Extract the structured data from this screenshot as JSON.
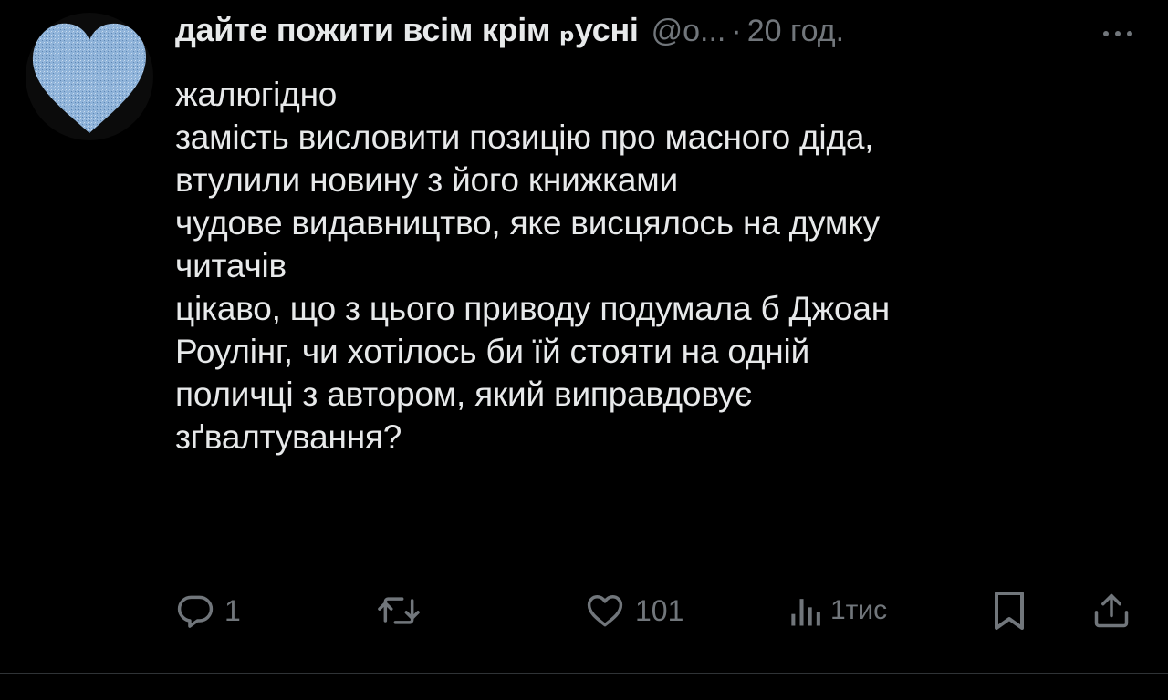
{
  "tweet": {
    "display_name": "дайте пожити всім крім ₚусні",
    "handle": "@o...",
    "separator": "·",
    "time": "20 год.",
    "body_lines": [
      "жалюгідно",
      "замість висловити позицію про масного діда,",
      "втулили новину з його книжками",
      "чудове видавництво, яке висцялось на думку",
      "читачів",
      "цікаво, що з цього приводу подумала б Джоан",
      "Роулінг, чи хотілось би їй стояти на одній",
      "поличці з автором, який виправдовує",
      "зґвалтування?"
    ],
    "avatar_icon": "blue-heart-avatar"
  },
  "actions": {
    "reply": {
      "icon": "reply-icon",
      "count": "1"
    },
    "retweet": {
      "icon": "retweet-icon",
      "count": ""
    },
    "like": {
      "icon": "heart-icon",
      "count": "101"
    },
    "views": {
      "icon": "views-icon",
      "count": "1тис"
    },
    "bookmark": {
      "icon": "bookmark-icon"
    },
    "share": {
      "icon": "share-icon"
    }
  },
  "colors": {
    "background": "#000000",
    "text_primary": "#e7e9ea",
    "text_secondary": "#71767b",
    "avatar_heart": "#8fb3d9"
  }
}
